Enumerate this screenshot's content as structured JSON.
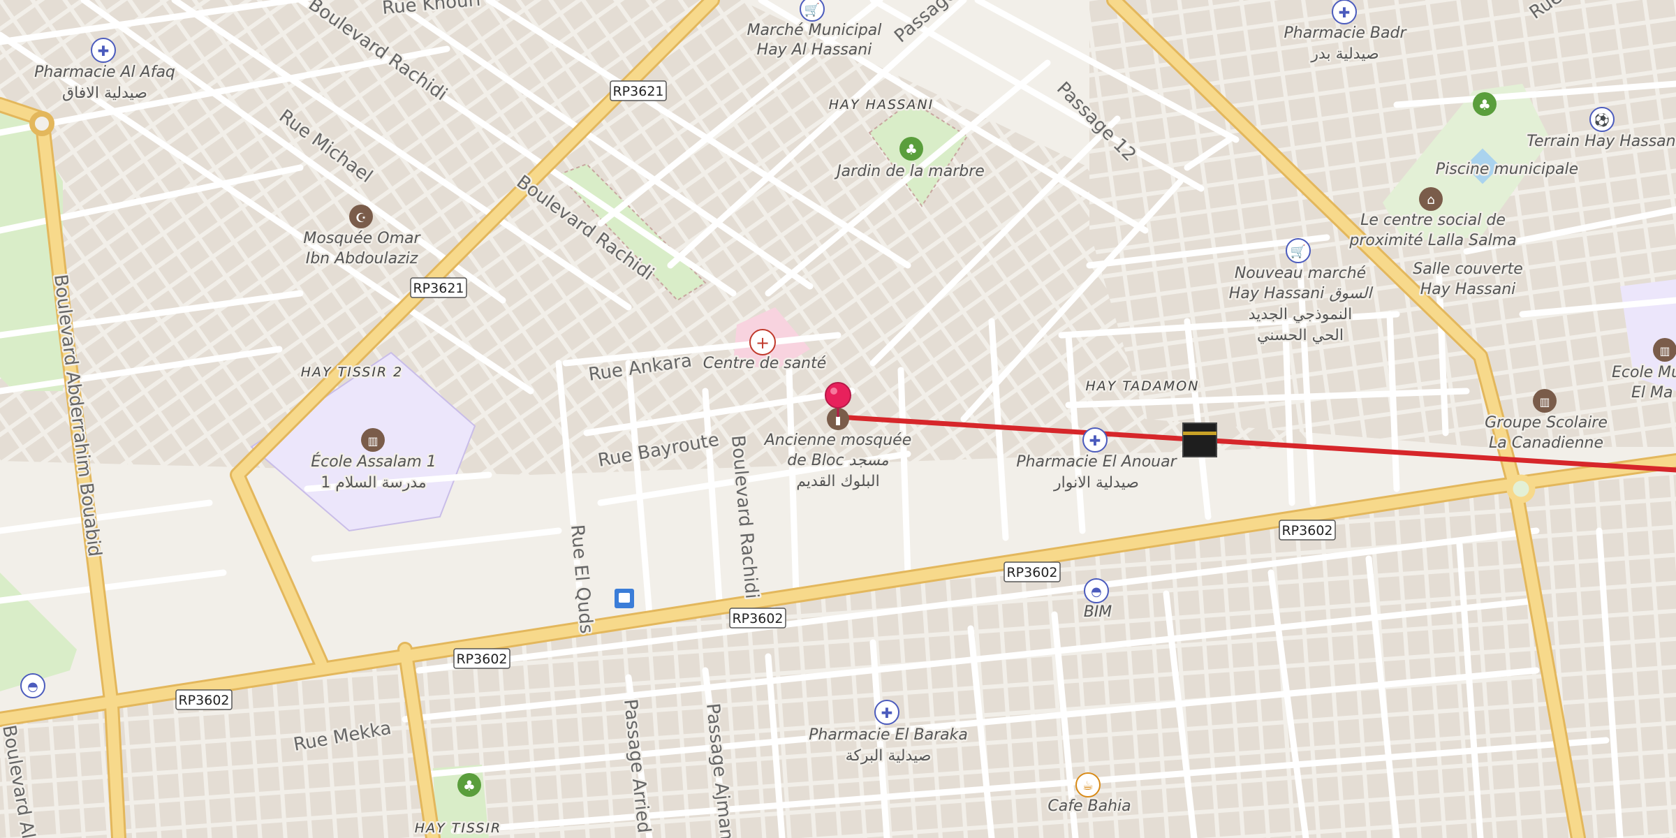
{
  "map": {
    "colors": {
      "background": "#f2efe9",
      "building": "#e4ddd4",
      "primary_road": "#f7d98b",
      "primary_road_casing": "#e3b75c",
      "street": "#ffffff",
      "park": "#d9edc8",
      "school": "#ece6fb",
      "hospital": "#f8d3df",
      "route_line": "#d6262a",
      "pin": "#e8215c",
      "poi_blue": "#4b5bbd",
      "poi_green": "#5a9e3c",
      "poi_brown": "#7a5c4a",
      "poi_orange": "#d88a16"
    },
    "districts": [
      "HAY HASSANI",
      "HAY TISSIR 2",
      "HAY TADAMON",
      "HAY TISSIR"
    ],
    "streets": [
      "Rue Khouri",
      "Boulevard Rachidi",
      "Rue Michael",
      "Boulevard Rachidi",
      "Passage",
      "Passage 12",
      "Rue Ankara",
      "Rue Bayroute",
      "Boulevard Rachidi",
      "Rue El Quds",
      "Boulevard Abderrahim Bouabid",
      "Rue Mekka",
      "Passage Arried",
      "Passage Ajmane",
      "Boulevard Al",
      "Rue"
    ],
    "shields": [
      "RP3621",
      "RP3621",
      "RP3602",
      "RP3602",
      "RP3602",
      "RP3602",
      "RP3602"
    ],
    "pois": [
      {
        "name": "Pharmacie Al Afaq",
        "name_ar": "صيدلية الافاق",
        "icon": "pharmacy-icon"
      },
      {
        "name": "Marché Municipal",
        "name2": "Hay Al Hassani",
        "icon": "market-icon"
      },
      {
        "name": "Pharmacie Badr",
        "name_ar": "صيدلية بدر",
        "icon": "pharmacy-icon"
      },
      {
        "name": "Terrain Hay Hassani",
        "icon": "sports-icon"
      },
      {
        "name": "Jardin de la marbre",
        "icon": "park-icon"
      },
      {
        "name": "Piscine municipale",
        "icon": "pool-icon"
      },
      {
        "name": "Le centre social de",
        "name2": "proximité Lalla Salma",
        "icon": "community-icon"
      },
      {
        "name": "Mosquée Omar",
        "name2": "Ibn Abdoulaziz",
        "icon": "mosque-icon"
      },
      {
        "name": "Nouveau marché",
        "name2": "Hay Hassani السوق",
        "name3": "النموذجي الجديد",
        "name4": "الحي الحسني",
        "icon": "market-icon"
      },
      {
        "name": "Salle couverte",
        "name2": "Hay Hassani",
        "icon": "none"
      },
      {
        "name": "Centre de santé",
        "icon": "health-icon"
      },
      {
        "name": "Ancienne mosquée",
        "name2": "de Bloc مسجد",
        "name3": "البلوك القديم",
        "icon": "monument-icon"
      },
      {
        "name": "Pharmacie El Anouar",
        "name_ar": "صيدلية الانوار",
        "icon": "pharmacy-icon"
      },
      {
        "name": "Groupe Scolaire",
        "name2": "La Canadienne",
        "icon": "school-icon"
      },
      {
        "name": "Ecole Mu",
        "name2": "El Ma",
        "icon": "school-icon"
      },
      {
        "name": "École Assalam 1",
        "name_ar": "مدرسة السلام 1",
        "icon": "school-icon"
      },
      {
        "name": "BIM",
        "icon": "shop-icon"
      },
      {
        "name": "Pharmacie El Baraka",
        "name_ar": "صيدلية البركة",
        "icon": "pharmacy-icon"
      },
      {
        "name": "Cafe Bahia",
        "icon": "cafe-icon"
      }
    ],
    "route": {
      "from_icon": "location-pin-icon",
      "to_icon": "kaaba-icon"
    }
  }
}
